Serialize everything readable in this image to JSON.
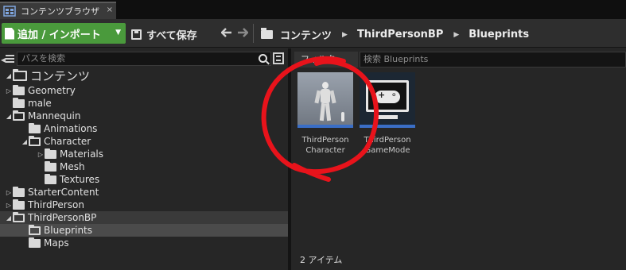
{
  "tab": {
    "title": "コンテンツブラウザ",
    "close": "×"
  },
  "toolbar": {
    "add_import_label": "追加 / インポート",
    "save_all_label": "すべて保存",
    "back_arrow": "🡐",
    "forward_arrow": "🡒"
  },
  "breadcrumbs": [
    "コンテンツ",
    "ThirdPersonBP",
    "Blueprints"
  ],
  "left_panel": {
    "search_placeholder": "パスを検索",
    "tree": [
      {
        "label": "コンテンツ",
        "depth": 0,
        "expanded": true,
        "root": true
      },
      {
        "label": "Geometry",
        "depth": 0,
        "expanded": false,
        "has_children": true
      },
      {
        "label": "male",
        "depth": 0,
        "has_children": false
      },
      {
        "label": "Mannequin",
        "depth": 0,
        "expanded": true,
        "has_children": true
      },
      {
        "label": "Animations",
        "depth": 1,
        "has_children": false
      },
      {
        "label": "Character",
        "depth": 1,
        "expanded": true,
        "has_children": true
      },
      {
        "label": "Materials",
        "depth": 2,
        "expanded": false,
        "has_children": true
      },
      {
        "label": "Mesh",
        "depth": 2,
        "has_children": false
      },
      {
        "label": "Textures",
        "depth": 2,
        "has_children": false
      },
      {
        "label": "StarterContent",
        "depth": 0,
        "expanded": false,
        "has_children": true
      },
      {
        "label": "ThirdPerson",
        "depth": 0,
        "expanded": false,
        "has_children": true
      },
      {
        "label": "ThirdPersonBP",
        "depth": 0,
        "expanded": true,
        "has_children": true,
        "highlight": true
      },
      {
        "label": "Blueprints",
        "depth": 1,
        "has_children": false,
        "selected": true
      },
      {
        "label": "Maps",
        "depth": 1,
        "has_children": false
      }
    ]
  },
  "right_panel": {
    "filter_label": "フィルタ",
    "search_placeholder": "検索 Blueprints",
    "assets": [
      {
        "label": "ThirdPerson\nCharacter",
        "icon": "character-mannequin-icon"
      },
      {
        "label": "ThirdPerson\nGameMode",
        "icon": "gamepad-monitor-icon"
      }
    ],
    "item_count": "2 アイテム"
  },
  "colors": {
    "add_button": "#4a9a3c",
    "asset_type_bar": "#3a6ec6",
    "annotation": "#e8131b"
  }
}
